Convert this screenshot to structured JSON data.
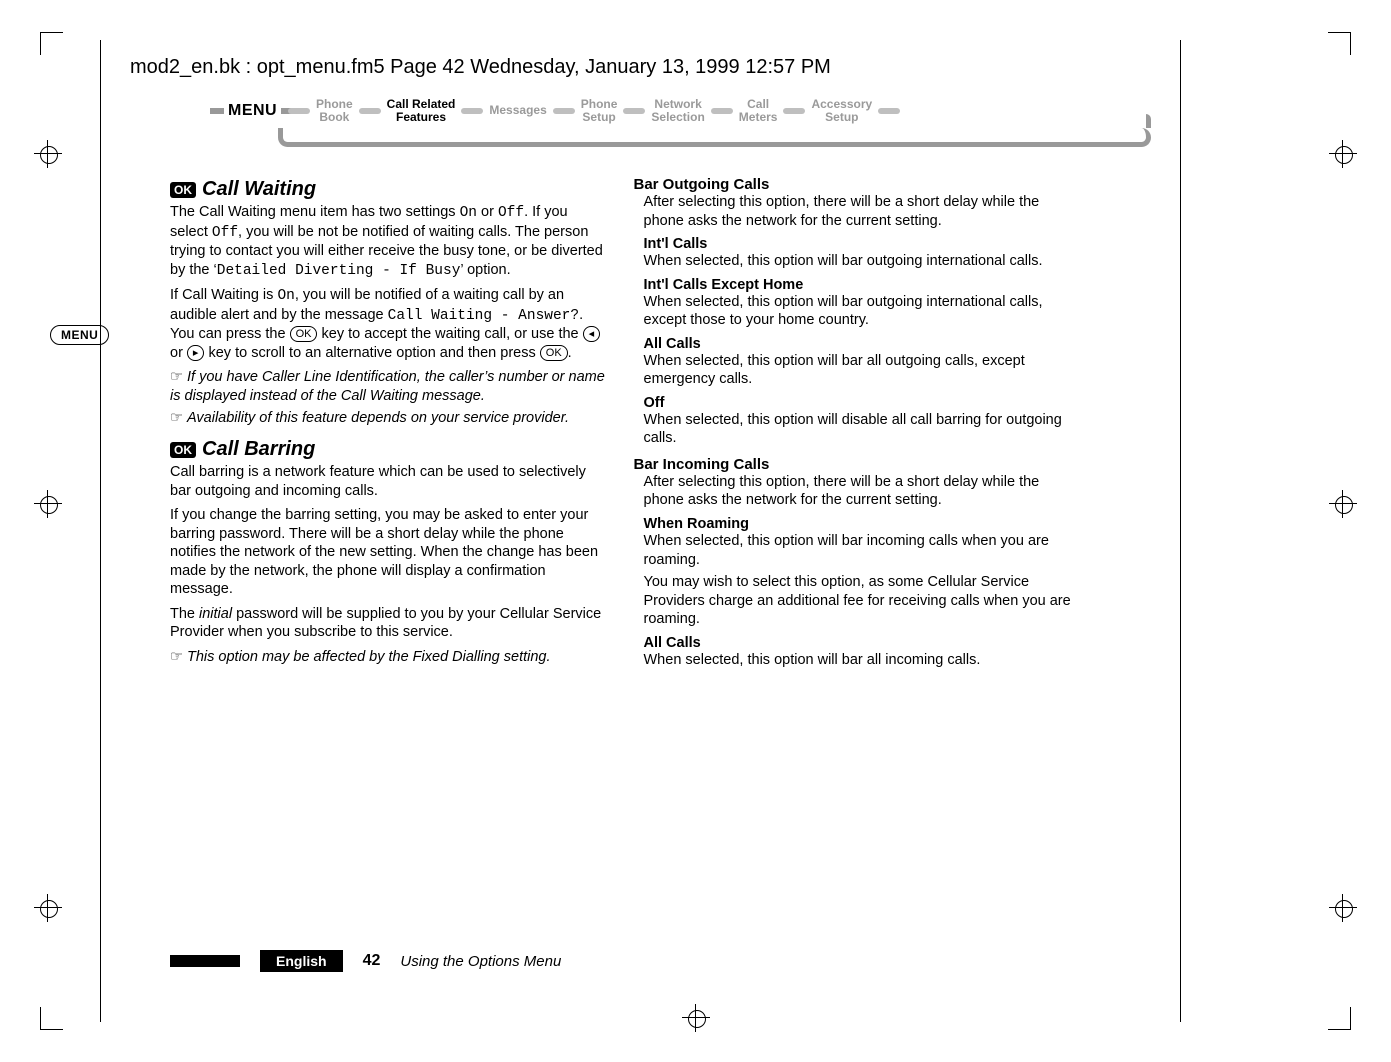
{
  "header_line": "mod2_en.bk : opt_menu.fm5  Page 42  Wednesday, January 13, 1999  12:57 PM",
  "breadcrumb": {
    "menu_label": "MENU",
    "items": [
      {
        "l1": "Phone",
        "l2": "Book",
        "active": false
      },
      {
        "l1": "Call Related",
        "l2": "Features",
        "active": true
      },
      {
        "l1": "Messages",
        "l2": "",
        "active": false
      },
      {
        "l1": "Phone",
        "l2": "Setup",
        "active": false
      },
      {
        "l1": "Network",
        "l2": "Selection",
        "active": false
      },
      {
        "l1": "Call",
        "l2": "Meters",
        "active": false
      },
      {
        "l1": "Accessory",
        "l2": "Setup",
        "active": false
      }
    ]
  },
  "menu_badge": "MENU",
  "keys": {
    "ok": "OK",
    "left": "◂",
    "right": "▸"
  },
  "left": {
    "call_waiting": {
      "title": "Call Waiting",
      "p1a": "The Call Waiting menu item has two settings ",
      "p1_on": "On",
      "p1_or": " or ",
      "p1_off": "Off",
      "p1b": ". If you select ",
      "p1_off2": "Off",
      "p1c": ", you will be not be notified of waiting calls. The person trying to contact you will either receive the busy tone, or be diverted by the ‘",
      "p1_detail": "Detailed Diverting - If Busy",
      "p1d": "’ option.",
      "p2a": "If Call Waiting is ",
      "p2_on": "On",
      "p2b": ", you will be notified of a waiting call by an audible alert and by the message ",
      "p2_msg": "Call Waiting - Answer?",
      "p2c": ". You can press the ",
      "p2d": " key to accept the waiting call, or use the ",
      "p2e": " or ",
      "p2f": " key to scroll to an alternative option and then press ",
      "p2g": ".",
      "note1": "If you have Caller Line Identification, the caller’s number or name is displayed instead of the Call Waiting message.",
      "note2": "Availability of this feature depends on your service provider."
    },
    "call_barring": {
      "title": "Call Barring",
      "p1": "Call barring is a network feature which can be used to selectively bar outgoing and incoming calls.",
      "p2": "If you change the barring setting, you may be asked to enter your barring password. There will be a short delay while the phone notifies the network of the new setting. When the change has been made by the network, the phone will display a confirmation message.",
      "p3a": "The ",
      "p3_initial": "initial",
      "p3b": " password will be supplied to you by your Cellular Service Provider when you subscribe to this service.",
      "note": "This option may be affected by the Fixed Dialling setting."
    }
  },
  "right": {
    "bar_out": {
      "title": "Bar Outgoing Calls",
      "p": "After selecting this option, there will be a short delay while the phone asks the network for the current setting.",
      "intl_title": "Int'l Calls",
      "intl_p": "When selected, this option will bar outgoing international calls.",
      "intl_ex_title": "Int'l Calls Except Home",
      "intl_ex_p": "When selected, this option will bar outgoing international calls, except those to your home country.",
      "all_title": "All Calls",
      "all_p": "When selected, this option will bar all outgoing calls, except emergency calls.",
      "off_title": "Off",
      "off_p": "When selected, this option will disable all call barring for outgoing calls."
    },
    "bar_in": {
      "title": "Bar Incoming Calls",
      "p": "After selecting this option, there will be a short delay while the phone asks the network for the current setting.",
      "roam_title": "When Roaming",
      "roam_p1": "When selected, this option will bar incoming calls when you are roaming.",
      "roam_p2": "You may wish to select this option, as some Cellular Service Providers charge an additional fee for receiving calls when you are roaming.",
      "all_title": "All Calls",
      "all_p": "When selected, this option will bar all incoming calls."
    }
  },
  "footer": {
    "language": "English",
    "page": "42",
    "chapter": "Using the Options Menu"
  }
}
